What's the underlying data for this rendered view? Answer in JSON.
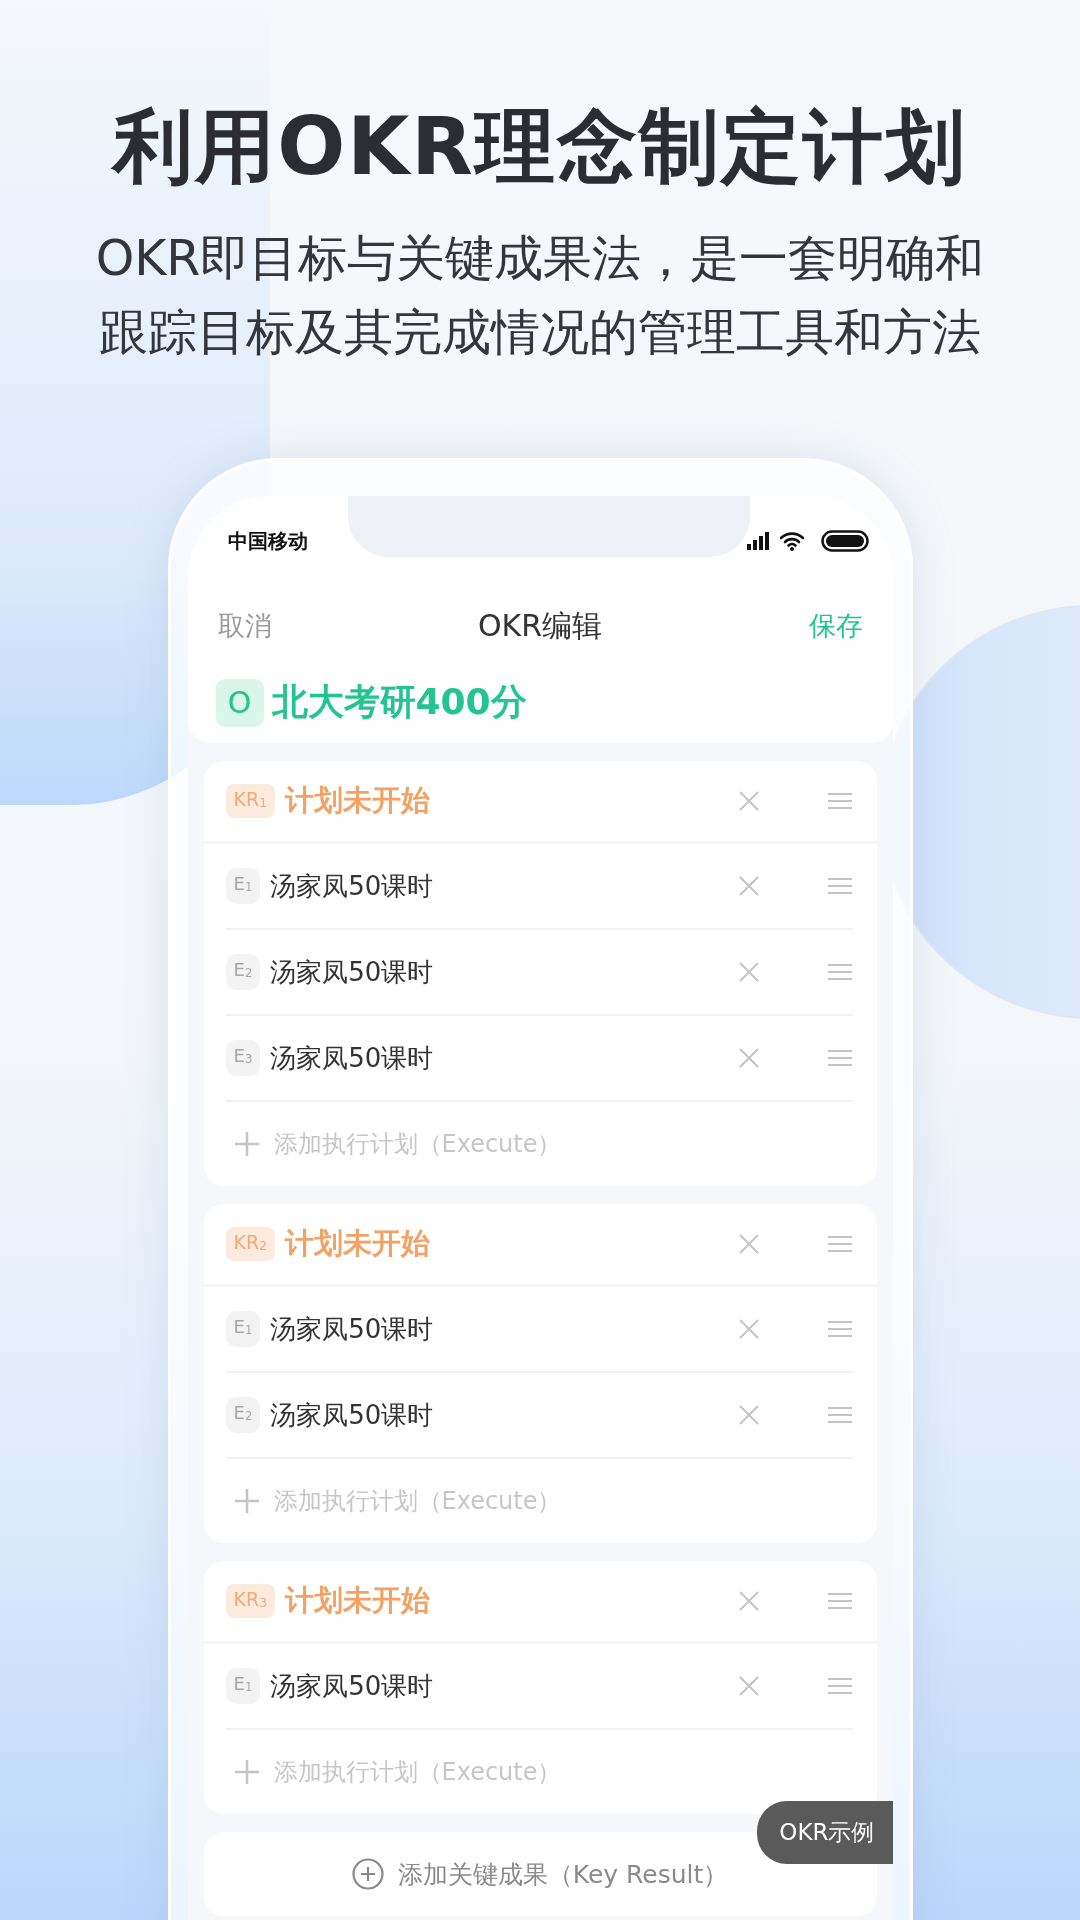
{
  "headline": "利用OKR理念制定计划",
  "subtitle_lines": [
    "OKR即目标与关键成果法，是一套明确和",
    "跟踪目标及其完成情况的管理工具和方法"
  ],
  "status_bar": {
    "carrier": "中国移动"
  },
  "nav": {
    "cancel": "取消",
    "title": "OKR编辑",
    "save": "保存"
  },
  "objective": {
    "badge": "O",
    "title": "北大考研400分"
  },
  "key_results": [
    {
      "badge": "KR$_{1}$",
      "title": "计划未开始",
      "executions": [
        {
          "badge": "E$_{1}$",
          "text": "汤家凤50课时"
        },
        {
          "badge": "E$_{2}$",
          "text": "汤家凤50课时"
        },
        {
          "badge": "E$_{3}$",
          "text": "汤家凤50课时"
        }
      ],
      "add_label": "添加执行计划（Execute）"
    },
    {
      "badge": "KR$_{2}$",
      "title": "计划未开始",
      "executions": [
        {
          "badge": "E$_{1}$",
          "text": "汤家凤50课时"
        },
        {
          "badge": "E$_{2}$",
          "text": "汤家凤50课时"
        }
      ],
      "add_label": "添加执行计划（Execute）"
    },
    {
      "badge": "KR$_{3}$",
      "title": "计划未开始",
      "executions": [
        {
          "badge": "E$_{1}$",
          "text": "汤家凤50课时"
        }
      ],
      "add_label": "添加执行计划（Execute）"
    }
  ],
  "add_key_result": "添加关键成果（Key Result）",
  "example_button": "OKR示例"
}
